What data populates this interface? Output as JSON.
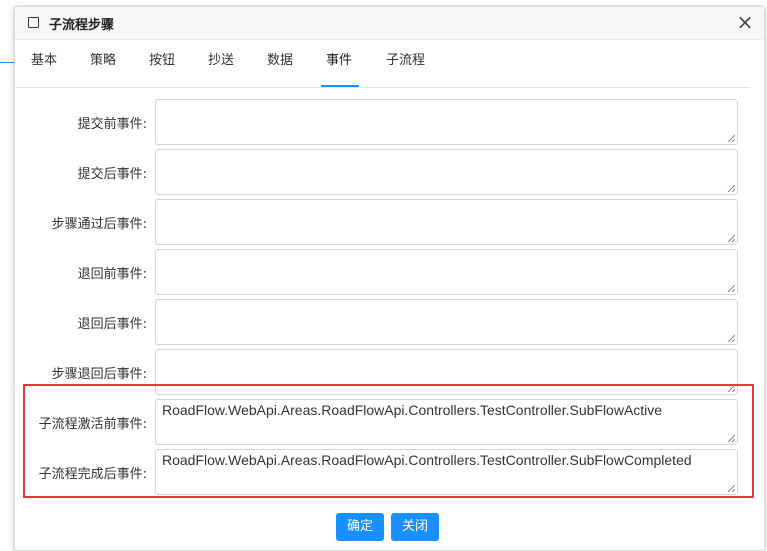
{
  "dialog": {
    "title": "子流程步骤",
    "close_symbol": "×"
  },
  "tabs": [
    {
      "label": "基本"
    },
    {
      "label": "策略"
    },
    {
      "label": "按钮"
    },
    {
      "label": "抄送"
    },
    {
      "label": "数据"
    },
    {
      "label": "事件",
      "active": true
    },
    {
      "label": "子流程"
    }
  ],
  "fields": [
    {
      "label": "提交前事件:",
      "value": ""
    },
    {
      "label": "提交后事件:",
      "value": ""
    },
    {
      "label": "步骤通过后事件:",
      "value": ""
    },
    {
      "label": "退回前事件:",
      "value": ""
    },
    {
      "label": "退回后事件:",
      "value": ""
    },
    {
      "label": "步骤退回后事件:",
      "value": ""
    },
    {
      "label": "子流程激活前事件:",
      "value": "RoadFlow.WebApi.Areas.RoadFlowApi.Controllers.TestController.SubFlowActive"
    },
    {
      "label": "子流程完成后事件:",
      "value": "RoadFlow.WebApi.Areas.RoadFlowApi.Controllers.TestController.SubFlowCompleted"
    }
  ],
  "buttons": {
    "confirm": "确定",
    "close": "关闭"
  },
  "colors": {
    "accent": "#1890ff",
    "highlight": "#e53935"
  }
}
